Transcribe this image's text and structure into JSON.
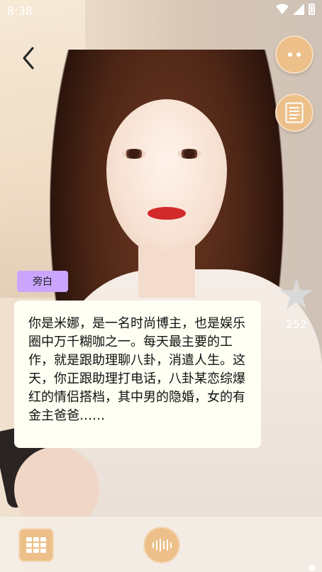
{
  "status_bar": {
    "time": "8:38"
  },
  "narrator": {
    "tag": "旁白"
  },
  "story": {
    "text": "你是米娜，是一名时尚博主，也是娱乐圈中万千糊咖之一。每天最主要的工作，就是跟助理聊八卦，消遣人生。这天，你正跟助理打电话，八卦某恋综爆红的情侣搭档，其中男的隐婚，女的有金主爸爸……"
  },
  "rating": {
    "count": "252"
  },
  "icons": {
    "back": "chevron-left-icon",
    "more": "more-dots-icon",
    "script": "document-icon",
    "star": "star-icon",
    "menu": "grid-menu-icon",
    "voice": "voice-wave-icon"
  },
  "colors": {
    "accent": "#edc08a",
    "tag_bg": "#c9a5ff",
    "card_bg": "#fffff3"
  }
}
